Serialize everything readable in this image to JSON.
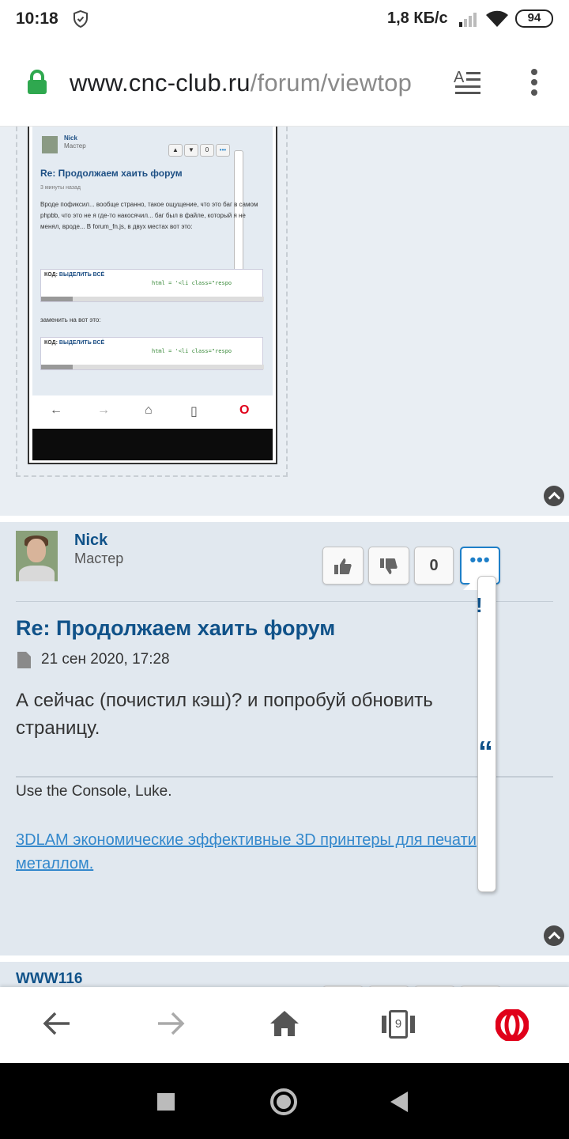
{
  "status_bar": {
    "time": "10:18",
    "net_speed": "1,8 КБ/с",
    "battery": "94"
  },
  "browser": {
    "url_domain": "www.cnc-club.ru",
    "url_path": "/forum/viewtop",
    "tab_count": "9",
    "accent_color": "#e0001a"
  },
  "screenshot_attachment": {
    "author": "Nick",
    "rank": "Мастер",
    "score": "0",
    "title": "Re: Продолжаем хаить форум",
    "date": "3 минуты назад",
    "body": "Вроде пофиксил... вообще странно, такое ощущение, что это баг в самом phpbb, что это не я где-то накосячил... баг был в файле, который я не менял, вроде... В forum_fn.js, в двух местах вот это:",
    "code_header": "КОД:",
    "code_select": "ВЫДЕЛИТЬ ВСЁ",
    "code_line": "html = '<li class=\"respo",
    "replace_text": "заменить на вот это:"
  },
  "post": {
    "author": "Nick",
    "rank": "Мастер",
    "score": "0",
    "more_label": "•••",
    "title": "Re: Продолжаем хаить форум",
    "date": "21 сен 2020, 17:28",
    "body": "А сейчас (почистил кэш)? и попробуй обновить страницу.",
    "signature": "Use the Console, Luke.",
    "signature_link": "3DLAM экономические эффективные 3D принтеры для печати металлом."
  },
  "next_post": {
    "author": "WWW116"
  },
  "colors": {
    "post_bg": "#e1e8ef",
    "link": "#105289",
    "signature_link": "#3388cc"
  }
}
